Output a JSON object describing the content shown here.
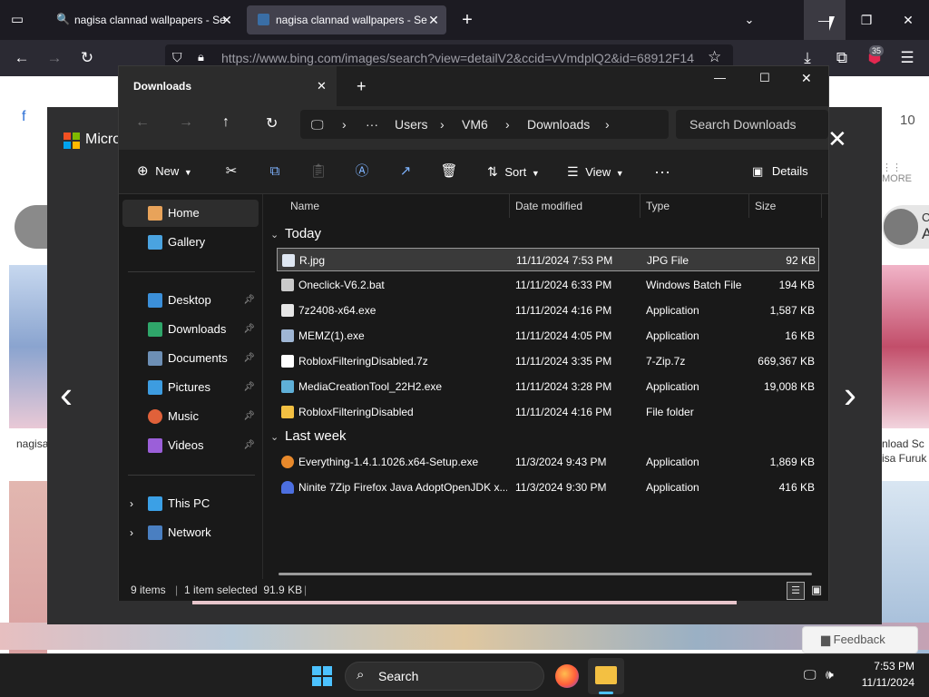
{
  "browser": {
    "tabs": [
      {
        "title": "nagisa clannad wallpapers - Se",
        "active": false
      },
      {
        "title": "nagisa clannad wallpapers - Se",
        "active": true
      }
    ],
    "url": "https://www.bing.com/images/search?view=detailV2&ccid=vVmdplQ2&id=68912F14",
    "extension_badge": "35",
    "new_tab_glyph": "+"
  },
  "page_behind": {
    "brand_text": "Micro",
    "count_text": "10",
    "more_label": "MORE",
    "caption_left": "nagisa clanna",
    "caption_right_1": "nload Sc",
    "caption_right_2": "isa Furuk",
    "feedback_label": "Feedback",
    "side_letter_1": "C",
    "side_letter_2": "A",
    "small_f": "f"
  },
  "explorer": {
    "tab_title": "Downloads",
    "breadcrumb": [
      "Users",
      "VM6",
      "Downloads"
    ],
    "search_placeholder": "Search Downloads",
    "commands": {
      "new": "New",
      "sort": "Sort",
      "view": "View",
      "details": "Details"
    },
    "nav": [
      {
        "label": "Home",
        "icon": "home-icon",
        "pinned": false,
        "selected": true
      },
      {
        "label": "Gallery",
        "icon": "gallery-icon",
        "pinned": false
      },
      {
        "label": "Desktop",
        "icon": "desktop-icon",
        "pinned": true
      },
      {
        "label": "Downloads",
        "icon": "downloads-icon",
        "pinned": true
      },
      {
        "label": "Documents",
        "icon": "documents-icon",
        "pinned": true
      },
      {
        "label": "Pictures",
        "icon": "pictures-icon",
        "pinned": true
      },
      {
        "label": "Music",
        "icon": "music-icon",
        "pinned": true
      },
      {
        "label": "Videos",
        "icon": "videos-icon",
        "pinned": true
      },
      {
        "label": "This PC",
        "icon": "this-pc-icon",
        "expandable": true
      },
      {
        "label": "Network",
        "icon": "network-icon",
        "expandable": true
      }
    ],
    "columns": {
      "name": "Name",
      "date": "Date modified",
      "type": "Type",
      "size": "Size"
    },
    "groups": [
      {
        "label": "Today",
        "files": [
          {
            "name": "R.jpg",
            "date": "11/11/2024 7:53 PM",
            "type": "JPG File",
            "size": "92 KB",
            "icon": "image-file-icon",
            "selected": true
          },
          {
            "name": "Oneclick-V6.2.bat",
            "date": "11/11/2024 6:33 PM",
            "type": "Windows Batch File",
            "size": "194 KB",
            "icon": "batch-file-icon"
          },
          {
            "name": "7z2408-x64.exe",
            "date": "11/11/2024 4:16 PM",
            "type": "Application",
            "size": "1,587 KB",
            "icon": "7zip-exe-icon"
          },
          {
            "name": "MEMZ(1).exe",
            "date": "11/11/2024 4:05 PM",
            "type": "Application",
            "size": "16 KB",
            "icon": "exe-icon"
          },
          {
            "name": "RobloxFilteringDisabled.7z",
            "date": "11/11/2024 3:35 PM",
            "type": "7-Zip.7z",
            "size": "669,367 KB",
            "icon": "archive-file-icon"
          },
          {
            "name": "MediaCreationTool_22H2.exe",
            "date": "11/11/2024 3:28 PM",
            "type": "Application",
            "size": "19,008 KB",
            "icon": "installer-exe-icon"
          },
          {
            "name": "RobloxFilteringDisabled",
            "date": "11/11/2024 4:16 PM",
            "type": "File folder",
            "size": "",
            "icon": "folder-icon"
          }
        ]
      },
      {
        "label": "Last week",
        "files": [
          {
            "name": "Everything-1.4.1.1026.x64-Setup.exe",
            "date": "11/3/2024 9:43 PM",
            "type": "Application",
            "size": "1,869 KB",
            "icon": "search-exe-icon"
          },
          {
            "name": "Ninite 7Zip Firefox Java AdoptOpenJDK x...",
            "date": "11/3/2024 9:30 PM",
            "type": "Application",
            "size": "416 KB",
            "icon": "ninite-exe-icon"
          }
        ]
      }
    ],
    "status": {
      "count": "9 items",
      "selection": "1 item selected  91.9 KB"
    }
  },
  "taskbar": {
    "search_label": "Search",
    "time": "7:53 PM",
    "date": "11/11/2024"
  },
  "colors": {
    "accent": "#0078d4",
    "folder": "#f3c042",
    "badge": "#e22850"
  }
}
